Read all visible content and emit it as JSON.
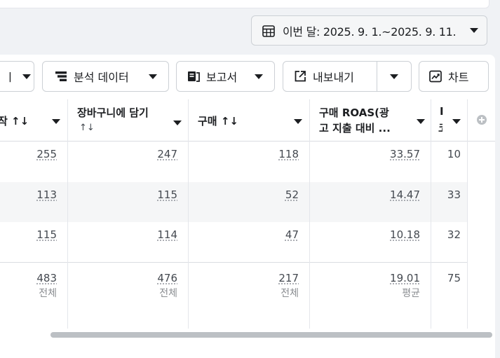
{
  "date_range": {
    "label": "이번 달: 2025. 9. 1.~2025. 9. 11."
  },
  "toolbar": {
    "partial_label": "ㅣ",
    "breakdown_label": "분석 데이터",
    "reports_label": "보고서",
    "export_label": "내보내기",
    "chart_label": "차트"
  },
  "columns": [
    {
      "label": "작 ↑↓"
    },
    {
      "label": "장바구니에 담기",
      "sort": "↑↓"
    },
    {
      "label": "구매 ↑↓"
    },
    {
      "label": "구매 ROAS(광",
      "label2": "고 지출 대비 ..."
    },
    {
      "label": "I",
      "label2": "코"
    }
  ],
  "rows": [
    {
      "c1": "255",
      "c2": "247",
      "c3": "118",
      "c4": "33.57",
      "c5": "10"
    },
    {
      "c1": "113",
      "c2": "115",
      "c3": "52",
      "c4": "14.47",
      "c5": "33"
    },
    {
      "c1": "115",
      "c2": "114",
      "c3": "47",
      "c4": "10.18",
      "c5": "32"
    }
  ],
  "totals": {
    "c1": "483",
    "c1_sub": "전체",
    "c2": "476",
    "c2_sub": "전체",
    "c3": "217",
    "c3_sub": "전체",
    "c4": "19.01",
    "c4_sub": "평균",
    "c5": "75"
  }
}
